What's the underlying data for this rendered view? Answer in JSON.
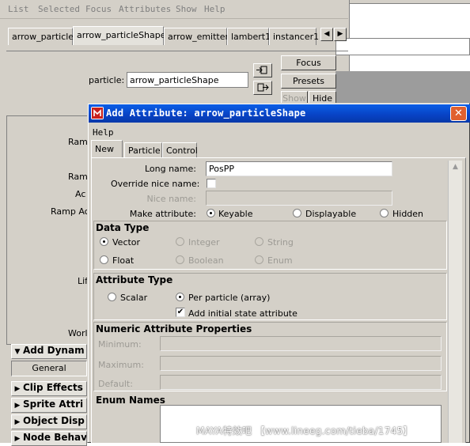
{
  "background_editor": {
    "menu": [
      "List",
      "Selected",
      "Focus",
      "Attributes",
      "Show",
      "Help"
    ],
    "tabs": [
      "arrow_particle",
      "arrow_particleShape",
      "arrow_emitter",
      "lambert1",
      "instancer1"
    ],
    "selected_tab": "arrow_particleShape",
    "particle_label": "particle:",
    "particle_value": "arrow_particleShape",
    "buttons": {
      "focus": "Focus",
      "presets": "Presets",
      "show": "Show",
      "hide": "Hide"
    },
    "partial_labels": [
      "Ram",
      "Ram",
      "Ac",
      "Ramp Ac",
      "Lif",
      "Worl"
    ],
    "sections": [
      "Add Dynam",
      "Clip Effects",
      "Sprite Attri",
      "Object Disp",
      "Node Behav"
    ],
    "general_label": "General"
  },
  "dialog": {
    "title": "Add Attribute: arrow_particleShape",
    "menu_help": "Help",
    "tabs": [
      "New",
      "Particle",
      "Control"
    ],
    "selected_tab": "New",
    "long_name_label": "Long name:",
    "long_name_value": "PosPP",
    "override_nice_name_label": "Override nice name:",
    "override_nice_name_checked": false,
    "nice_name_label": "Nice name:",
    "nice_name_value": "",
    "make_attribute_label": "Make attribute:",
    "make_attribute_options": [
      "Keyable",
      "Displayable",
      "Hidden"
    ],
    "make_attribute_selected": "Keyable",
    "data_type": {
      "title": "Data Type",
      "options": [
        "Vector",
        "Integer",
        "String",
        "Float",
        "Boolean",
        "Enum"
      ],
      "selected": "Vector"
    },
    "attribute_type": {
      "title": "Attribute Type",
      "options": [
        "Scalar",
        "Per particle (array)"
      ],
      "selected": "Per particle (array)",
      "initial_state_label": "Add initial state attribute",
      "initial_state_checked": true
    },
    "numeric": {
      "title": "Numeric Attribute Properties",
      "minimum_label": "Minimum:",
      "maximum_label": "Maximum:",
      "default_label": "Default:"
    },
    "enum_names_title": "Enum Names"
  },
  "watermark": "MAYA特效吧 【www.lineeg.com/tieba/1745】"
}
